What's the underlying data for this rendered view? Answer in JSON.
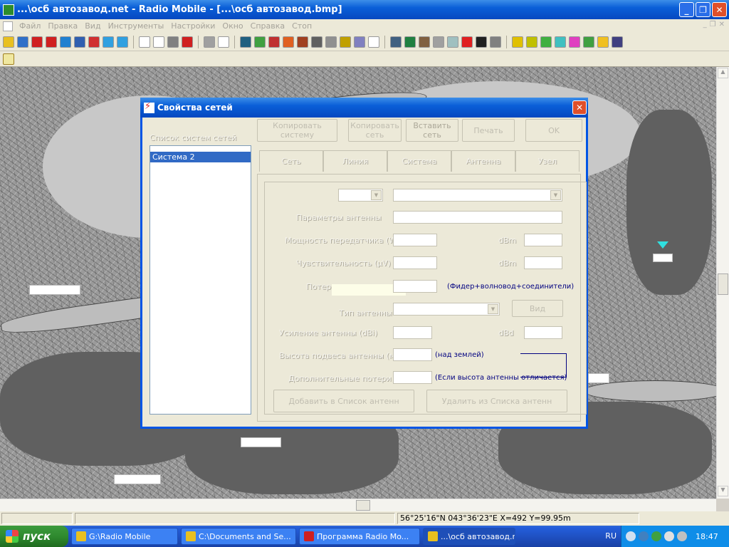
{
  "window": {
    "title": "...\\осб автозавод.net - Radio Mobile - [...\\осб автозавод.bmp]",
    "min_glyph": "_",
    "max_glyph": "❐",
    "close_glyph": "✕"
  },
  "menu": {
    "items": [
      "Файл",
      "Правка",
      "Вид",
      "Инструменты",
      "Настройки",
      "Окно",
      "Справка",
      "Стоп"
    ]
  },
  "mdi_controls": [
    "_",
    "❐",
    "✕"
  ],
  "toolbar_icons": [
    "open-icon",
    "save-icon",
    "network-icon",
    "antenna-icon",
    "world-icon",
    "print-icon",
    "zoom-icon",
    "arrow-left-icon",
    "arrow-right-icon",
    "blank-icon",
    "blank-icon",
    "printer-icon",
    "antenna-red-icon",
    "disk-icon",
    "new-icon",
    "map-icon",
    "radio-icon",
    "target-icon",
    "rainbow-icon",
    "pattern-icon",
    "bars-icon",
    "grid-icon",
    "panel-icon",
    "book-icon",
    "page-icon",
    "table-icon",
    "mountain-icon",
    "terrain-icon",
    "cross-grid-icon",
    "cross-dots-icon",
    "red-x-icon",
    "black-x-icon",
    "dots-icon",
    "circle-icon",
    "yellow-ball-icon",
    "green-ball-icon",
    "teal-icon",
    "pie-icon",
    "picture-icon",
    "star-icon",
    "barcode-icon"
  ],
  "toolbar_colors": [
    "#e8c020",
    "#3070c8",
    "#d02020",
    "#d02020",
    "#2080d0",
    "#3060b0",
    "#d03030",
    "#30a0e0",
    "#30a0e0",
    "#ffffff",
    "#ffffff",
    "#808080",
    "#d02020",
    "#a0a0a0",
    "#ffffff",
    "#206080",
    "#40a040",
    "#c03030",
    "#e06020",
    "#a04020",
    "#606060",
    "#909090",
    "#c0a000",
    "#8080c0",
    "#ffffff",
    "#406080",
    "#208040",
    "#806040",
    "#a0a0a0",
    "#a0c0c0",
    "#e02020",
    "#202020",
    "#808080",
    "#e0c000",
    "#c0c000",
    "#40b040",
    "#40c0c0",
    "#e040c0",
    "#40a040",
    "#f0c020",
    "#404080"
  ],
  "map": {
    "labels": [
      {
        "id": "label-1",
        "text": ""
      },
      {
        "id": "label-2",
        "text": ""
      },
      {
        "id": "label-3",
        "text": ""
      },
      {
        "id": "label-4",
        "text": ""
      },
      {
        "id": "label-5",
        "text": ""
      }
    ]
  },
  "statusbar": {
    "pane1": "",
    "pane2": "",
    "coords": "56°25'16\"N 043°36'23\"E  X=492 Y=99.95m"
  },
  "taskbar": {
    "start_label": "пуск",
    "tasks": [
      {
        "label": "G:\\Radio Mobile",
        "color": "#e8c020"
      },
      {
        "label": "C:\\Documents and Se...",
        "color": "#e8c020"
      },
      {
        "label": "Программа Radio Mo...",
        "color": "#d02020"
      },
      {
        "label": "...\\осб автозавод.ne...",
        "color": "#e8c020"
      }
    ],
    "lang": "RU",
    "clock": "18:47"
  },
  "dialog": {
    "title": "Свойства сетей",
    "close_glyph": "✕",
    "list_label": "Список систем сетей",
    "top_buttons": [
      "Копировать систему",
      "Копировать сеть",
      "Вставить сеть",
      "Печать",
      "OK"
    ],
    "systems": [
      "Система  2"
    ],
    "tabs": [
      "Сеть",
      "Линия",
      "Система",
      "Антенна",
      "Узел"
    ],
    "fields": {
      "antenna_params_label": "Параметры антенны",
      "transmit_power_label": "Мощность передатчика (W)",
      "dbm_label_1": "dBm",
      "receiver_threshold_label": "Чувствительность (µV)",
      "dbm_label_2": "dBm",
      "line_loss_label": "Потери в линии",
      "line_loss_note": "(Фидер+волновод+соединители)",
      "antenna_type_label": "Тип антенны",
      "view_button": "Вид",
      "antenna_gain_label": "Усиление антенны (dBi)",
      "dbd_label": "dBd",
      "antenna_height_label": "Высота подвеса антенны (м)",
      "antenna_height_note": "(над землей)",
      "additional_loss_label": "Дополнительные потери (dB)",
      "additional_loss_note": "(Если высота антенны отличается)"
    },
    "bottom_buttons": [
      "Добавить в Список антенн",
      "Удалить из Списка антенн"
    ]
  }
}
